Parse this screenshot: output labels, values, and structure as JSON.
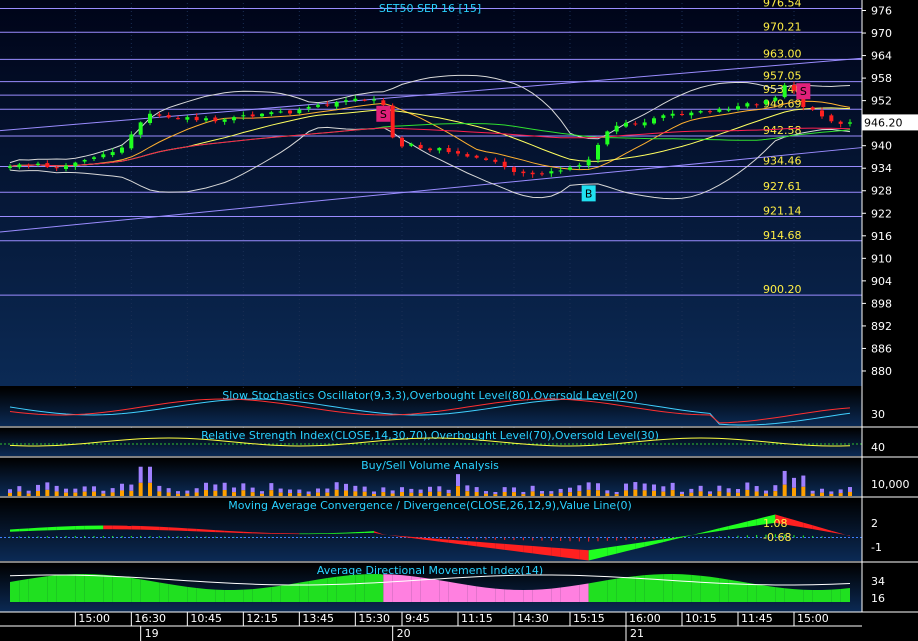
{
  "chart_data": {
    "type": "candlestick",
    "title": "SET50 SEP 16  [15]",
    "ylim": [
      876,
      978
    ],
    "y_ticks": [
      "976",
      "970",
      "964",
      "958",
      "952",
      "946",
      "940",
      "934",
      "928",
      "922",
      "916",
      "910",
      "904",
      "898",
      "892",
      "886",
      "880"
    ],
    "last_price": "946.20",
    "levels": [
      {
        "label": "976.54",
        "value": 976.54
      },
      {
        "label": "970.21",
        "value": 970.21
      },
      {
        "label": "963.00",
        "value": 963.0
      },
      {
        "label": "957.05",
        "value": 957.05
      },
      {
        "label": "953.46",
        "value": 953.46
      },
      {
        "label": "949.69",
        "value": 949.69
      },
      {
        "label": "942.58",
        "value": 942.58
      },
      {
        "label": "934.46",
        "value": 934.46
      },
      {
        "label": "927.61",
        "value": 927.61
      },
      {
        "label": "921.14",
        "value": 921.14
      },
      {
        "label": "914.68",
        "value": 914.68
      },
      {
        "label": "900.20",
        "value": 900.2
      }
    ],
    "signals": [
      {
        "label": "S",
        "type": "sell",
        "bar": 40,
        "price": 948.5
      },
      {
        "label": "B",
        "type": "buy",
        "bar": 62,
        "price": 927.3
      },
      {
        "label": "S",
        "type": "sell",
        "bar": 85,
        "price": 954.5
      }
    ],
    "close": [
      934.5,
      935,
      934.8,
      935.2,
      934.3,
      934,
      934.7,
      935.5,
      936.2,
      936.9,
      937.7,
      938.3,
      939.5,
      943,
      946.2,
      948.5,
      948,
      947.5,
      947.2,
      947.6,
      946.8,
      947.3,
      946.5,
      947,
      947.6,
      948.1,
      947.8,
      948.5,
      948.9,
      949.1,
      948.6,
      949.6,
      950.3,
      950.8,
      950.7,
      951.6,
      952.1,
      952.5,
      952,
      952.3,
      950.8,
      942.2,
      939.8,
      940.5,
      939.3,
      938.8,
      939.4,
      938.3,
      937.9,
      937.1,
      936.8,
      936.2,
      935.7,
      934.3,
      933,
      932.7,
      932.4,
      932.5,
      933.2,
      933.4,
      934.2,
      934.8,
      936.3,
      940.2,
      943.8,
      945.3,
      946.1,
      945.7,
      946.2,
      947.3,
      948.1,
      948.5,
      948.2,
      948.8,
      949.2,
      949,
      949.8,
      949.6,
      950.5,
      951.3,
      950.9,
      952.1,
      952.8,
      956.1,
      954.7,
      950.3,
      949.6,
      947.8,
      946.5,
      945.8,
      946.2
    ],
    "x_ticks": [
      {
        "label": "15:00",
        "bar": 7
      },
      {
        "label": "16:30",
        "bar": 13
      },
      {
        "label": "10:45",
        "bar": 19
      },
      {
        "label": "12:15",
        "bar": 25
      },
      {
        "label": "13:45",
        "bar": 31
      },
      {
        "label": "15:30",
        "bar": 37
      },
      {
        "label": "9:45",
        "bar": 42
      },
      {
        "label": "11:15",
        "bar": 48
      },
      {
        "label": "14:30",
        "bar": 54
      },
      {
        "label": "15:15",
        "bar": 60
      },
      {
        "label": "16:00",
        "bar": 66
      },
      {
        "label": "10:15",
        "bar": 72
      },
      {
        "label": "11:45",
        "bar": 78
      },
      {
        "label": "15:00",
        "bar": 84
      }
    ],
    "day_labels": [
      {
        "label": "19",
        "bar": 14
      },
      {
        "label": "20",
        "bar": 41
      },
      {
        "label": "21",
        "bar": 66
      }
    ],
    "panels": [
      {
        "key": "stoch",
        "title": "Slow Stochastics Oscillator(9,3,3),Overbought Level(80),Oversold Level(20)",
        "ticks": [
          "30"
        ]
      },
      {
        "key": "rsi",
        "title": "Relative Strength Index(CLOSE,14,30,70),Overbought Level(70),Oversold Level(30)",
        "ticks": [
          "40"
        ]
      },
      {
        "key": "volume",
        "title": "Buy/Sell Volume Analysis",
        "ticks": [
          "10,000"
        ]
      },
      {
        "key": "macd",
        "title": "Moving Average Convergence / Divergence(CLOSE,26,12,9),Value Line(0)",
        "ticks": [
          "2",
          "-1"
        ],
        "values": [
          "1.08",
          "-0.68"
        ]
      },
      {
        "key": "adx",
        "title": "Average Directional Movement Index(14)",
        "ticks": [
          "34",
          "16"
        ]
      }
    ]
  }
}
